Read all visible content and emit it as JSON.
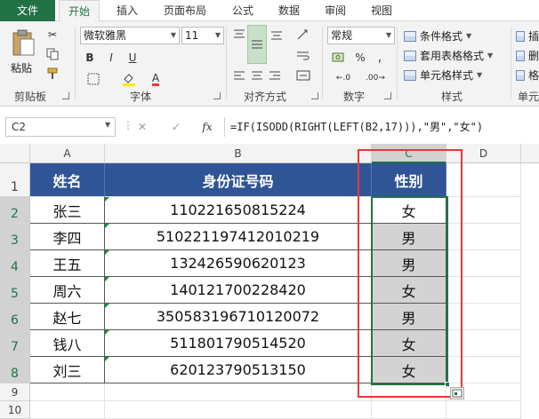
{
  "tabs": [
    "文件",
    "开始",
    "插入",
    "页面布局",
    "公式",
    "数据",
    "审阅",
    "视图"
  ],
  "active_tab": "开始",
  "ribbon": {
    "clipboard": {
      "paste_label": "粘贴",
      "group_label": "剪贴板"
    },
    "font": {
      "font_name": "微软雅黑",
      "font_size": "11",
      "bold": "B",
      "italic": "I",
      "underline": "U",
      "font_a": "A",
      "group_label": "字体"
    },
    "alignment": {
      "group_label": "对齐方式"
    },
    "number": {
      "format": "常规",
      "group_label": "数字"
    },
    "styles": {
      "conditional": "条件格式",
      "table": "套用表格格式",
      "cell": "单元格样式",
      "group_label": "样式"
    },
    "cells": {
      "insert": "插",
      "delete": "删",
      "format": "格",
      "group_label": "单元"
    }
  },
  "formula_bar": {
    "name_box": "C2",
    "cancel": "✕",
    "enter": "✓",
    "fx": "fx",
    "formula": "=IF(ISODD(RIGHT(LEFT(B2,17))),\"男\",\"女\")"
  },
  "columns": [
    "A",
    "B",
    "C",
    "D"
  ],
  "rows": [
    "1",
    "2",
    "3",
    "4",
    "5",
    "6",
    "7",
    "8",
    "9",
    "10"
  ],
  "table": {
    "headers": [
      "姓名",
      "身份证号码",
      "性别"
    ],
    "rows": [
      [
        "张三",
        "110221650815224",
        "女"
      ],
      [
        "李四",
        "510221197412010219",
        "男"
      ],
      [
        "王五",
        "132426590620123",
        "男"
      ],
      [
        "周六",
        "140121700228420",
        "女"
      ],
      [
        "赵七",
        "350583196710120072",
        "男"
      ],
      [
        "钱八",
        "511801790514520",
        "女"
      ],
      [
        "刘三",
        "620123790513150",
        "女"
      ]
    ]
  },
  "colors": {
    "excel_green": "#217346",
    "header_blue": "#2f5596",
    "highlight_red": "#e53935"
  }
}
